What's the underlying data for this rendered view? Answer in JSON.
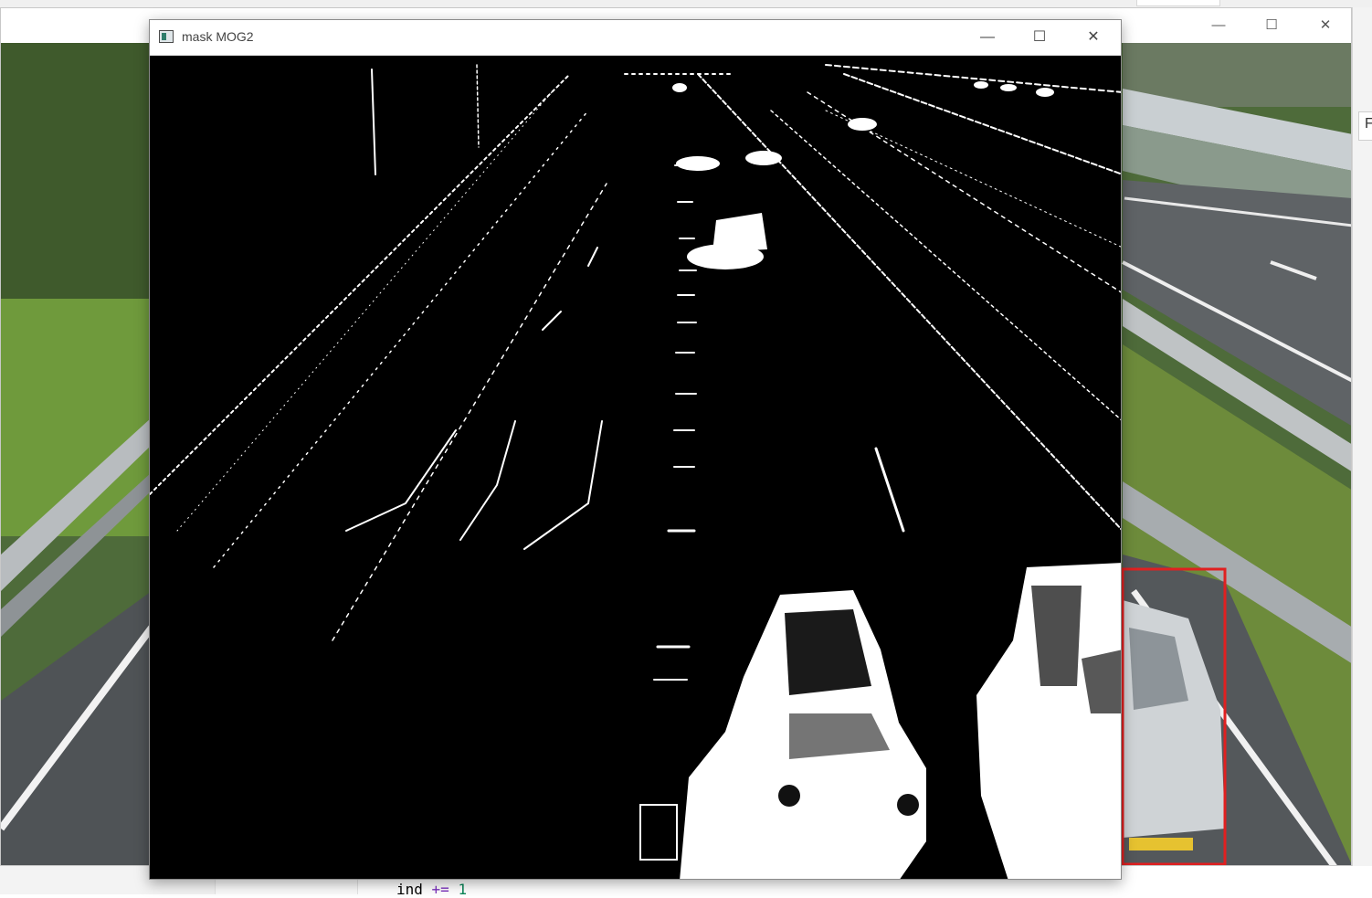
{
  "mask_window": {
    "title": "mask MOG2",
    "controls": {
      "minimize": "—",
      "maximize": "☐",
      "close": "✕"
    }
  },
  "frame_window": {
    "controls": {
      "minimize": "—",
      "maximize": "☐",
      "close": "✕"
    }
  },
  "editor": {
    "code_var": "ind",
    "code_op": "+=",
    "code_num": "1"
  },
  "right_panel": {
    "partial_char": "F"
  },
  "colors": {
    "detection_box": "#e02020",
    "mask_background": "#000000",
    "mask_foreground": "#ffffff"
  },
  "icons": [
    "app-icon",
    "minimize-icon",
    "maximize-icon",
    "close-icon"
  ]
}
